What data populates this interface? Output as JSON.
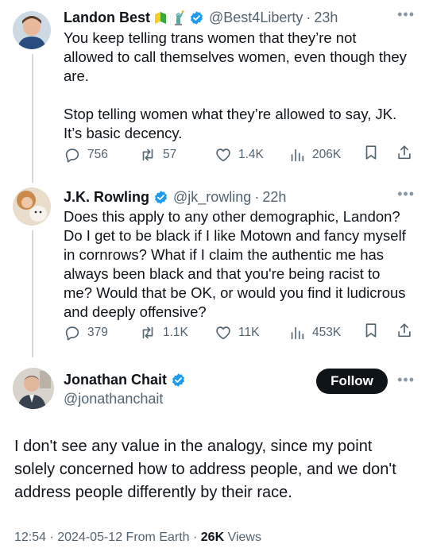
{
  "tweets": [
    {
      "author": "Landon Best",
      "handle": "@Best4Liberty",
      "time": "23h",
      "lines": [
        "You keep telling trans women that they’re not",
        "allowed to call themselves women, even though they",
        "are.",
        "",
        "Stop telling women what they’re allowed to say, JK.",
        "It’s basic decency."
      ],
      "replies": "756",
      "reposts": "57",
      "likes": "1.4K",
      "views": "206K"
    },
    {
      "author": "J.K. Rowling",
      "handle": "@jk_rowling",
      "time": "22h",
      "lines": [
        "Does this apply to any other demographic, Landon?",
        "Do I get to be black if I like Motown and fancy myself",
        "in cornrows? What if I claim the authentic me has",
        "always been black and that you're being racist to",
        "me? Would that be OK, or would you find it ludicrous",
        "and deeply offensive?"
      ],
      "replies": "379",
      "reposts": "1.1K",
      "likes": "11K",
      "views": "453K"
    }
  ],
  "main": {
    "author": "Jonathan Chait",
    "handle": "@jonathanchait",
    "follow_label": "Follow",
    "lines": [
      "I don't see any value in the analogy, since my point",
      "solely concerned how to address people, and we don't",
      "address people differently by their race."
    ],
    "meta_time": "12:54 · 2024-05-12 From Earth · ",
    "meta_views_count": "26K",
    "meta_views_label": " Views"
  },
  "colors": {
    "verified": "#1d9bf0",
    "secondary_text": "#536471",
    "thread_line": "#cfd9de",
    "follow_bg": "#0f1419"
  },
  "icons": [
    "verified-icon",
    "beginner-mark-icon",
    "statue-of-liberty-icon",
    "reply-icon",
    "repost-icon",
    "like-icon",
    "views-icon",
    "bookmark-icon",
    "share-icon",
    "more-icon"
  ]
}
